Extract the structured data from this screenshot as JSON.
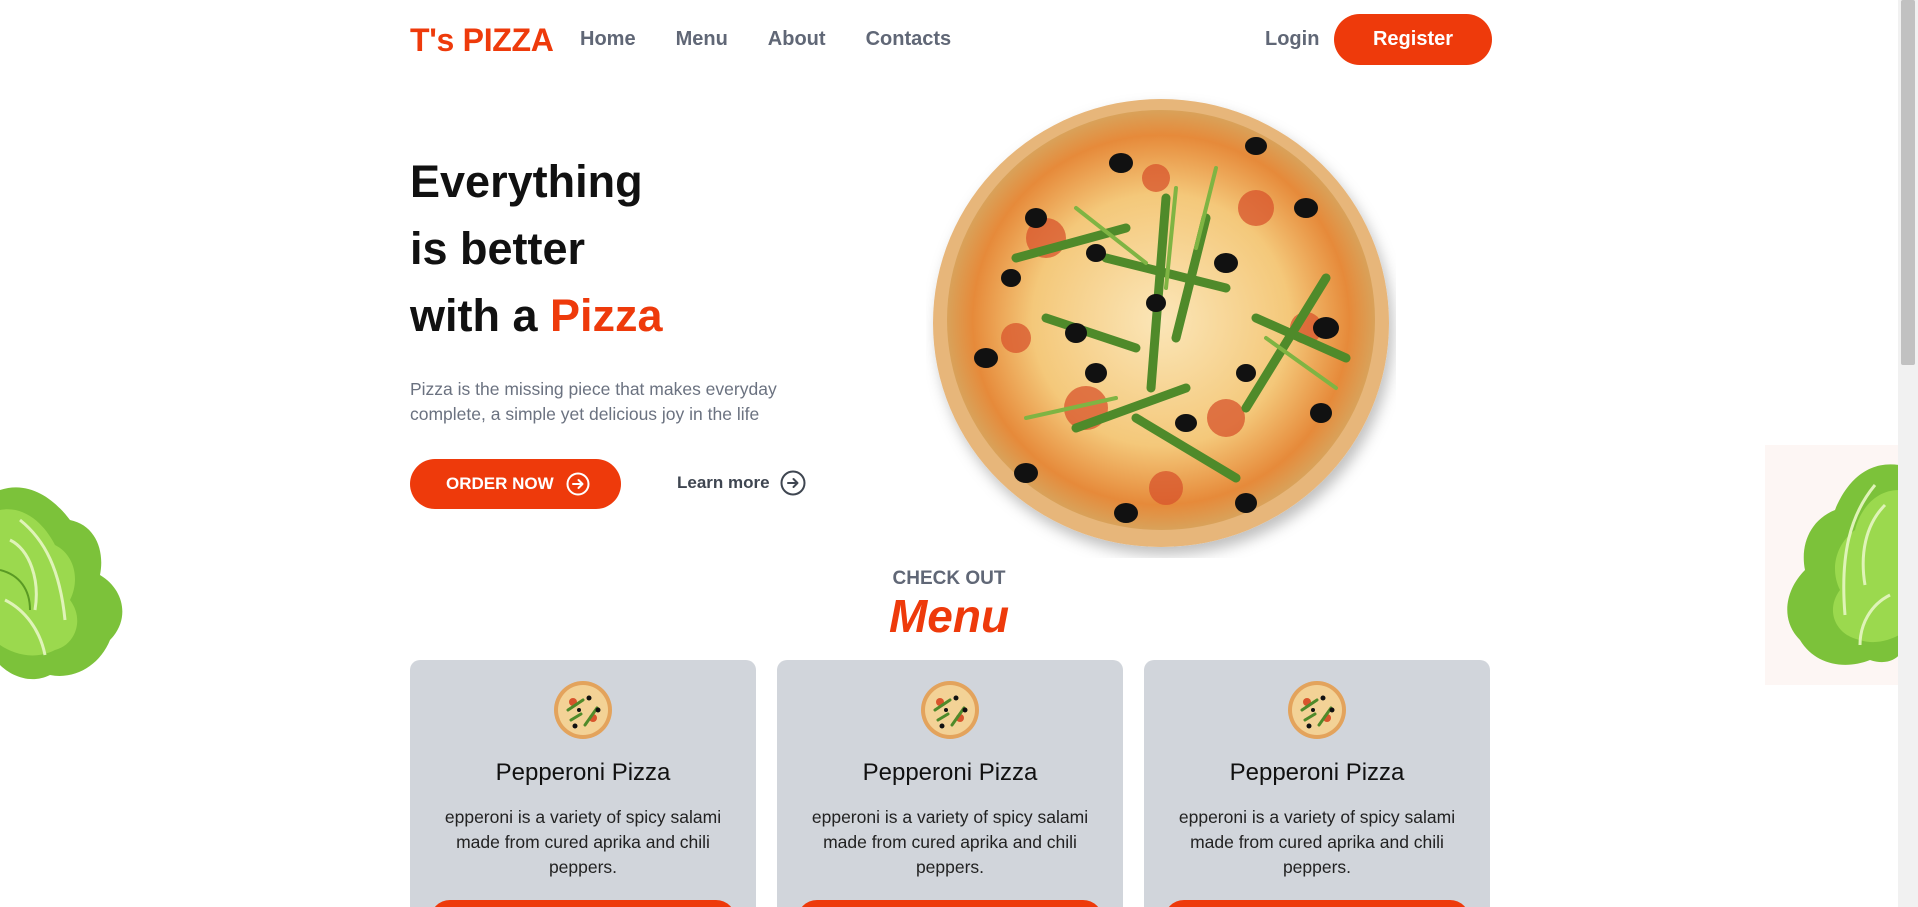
{
  "nav": {
    "logo": "T's PIZZA",
    "links": [
      "Home",
      "Menu",
      "About",
      "Contacts"
    ],
    "login": "Login",
    "register": "Register"
  },
  "hero": {
    "line1": "Everything",
    "line2": "is better",
    "line3_prefix": "with a ",
    "line3_accent": "Pizza",
    "description": "Pizza is the missing piece that makes everyday complete, a simple yet delicious joy in the life",
    "order_button": "ORDER NOW",
    "learn_more": "Learn more"
  },
  "menu_section": {
    "eyebrow": "CHECK OUT",
    "title": "Menu",
    "items": [
      {
        "name": "Pepperoni Pizza",
        "description": "epperoni is a variety of spicy salami made from cured aprika and chili peppers."
      },
      {
        "name": "Pepperoni Pizza",
        "description": "epperoni is a variety of spicy salami made from cured aprika and chili peppers."
      },
      {
        "name": "Pepperoni Pizza",
        "description": "epperoni is a variety of spicy salami made from cured aprika and chili peppers."
      }
    ]
  },
  "colors": {
    "accent": "#ee3a0b",
    "nav_text": "#606776",
    "card_bg": "#d1d5db"
  },
  "icons": {
    "order_arrow": "arrow-right-circle-icon",
    "learn_more_arrow": "arrow-right-circle-icon"
  }
}
